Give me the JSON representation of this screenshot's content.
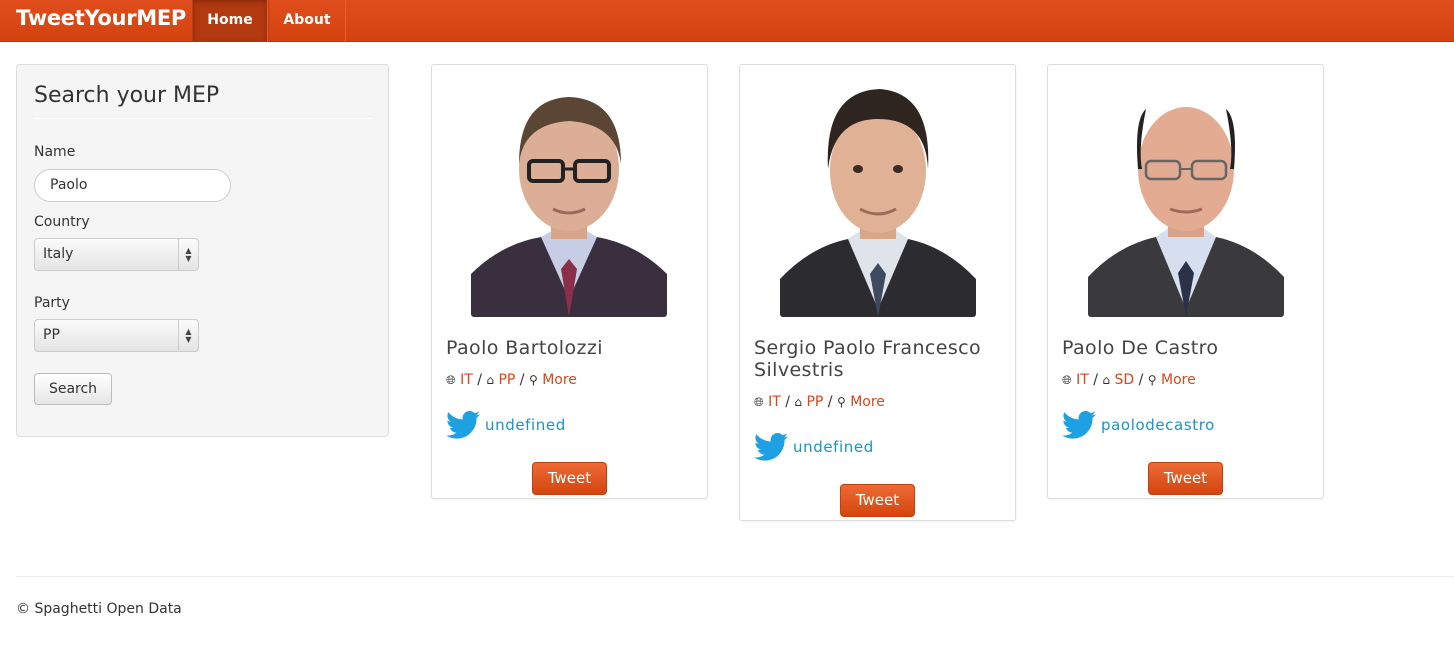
{
  "navbar": {
    "brand": "TweetYourMEP",
    "items": [
      {
        "label": "Home",
        "active": true
      },
      {
        "label": "About",
        "active": false
      }
    ],
    "color": "#d9461b"
  },
  "search": {
    "title": "Search your MEP",
    "name_label": "Name",
    "name_value": "Paolo",
    "country_label": "Country",
    "country_value": "Italy",
    "party_label": "Party",
    "party_value": "PP",
    "button_label": "Search"
  },
  "meps": [
    {
      "name": "Paolo Bartolozzi",
      "country": "IT",
      "party": "PP",
      "more": "More",
      "twitter": "undefined",
      "tweet_label": "Tweet"
    },
    {
      "name": "Sergio Paolo Francesco Silvestris",
      "country": "IT",
      "party": "PP",
      "more": "More",
      "twitter": "undefined",
      "tweet_label": "Tweet"
    },
    {
      "name": "Paolo De Castro",
      "country": "IT",
      "party": "SD",
      "more": "More",
      "twitter": "paolodecastro",
      "tweet_label": "Tweet"
    }
  ],
  "footer": {
    "text": "© Spaghetti Open Data"
  },
  "colors": {
    "accent": "#d9461b",
    "twitter": "#1a93c9"
  }
}
